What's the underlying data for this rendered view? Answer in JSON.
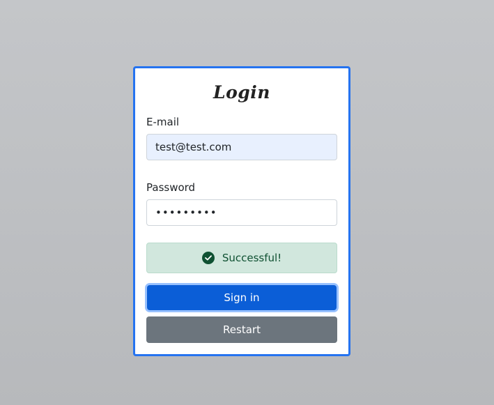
{
  "login": {
    "title": "Login",
    "email_label": "E-mail",
    "email_value": "test@test.com",
    "password_label": "Password",
    "password_value": "test12345",
    "alert_text": "Successful!",
    "signin_label": "Sign in",
    "restart_label": "Restart"
  },
  "colors": {
    "card_border": "#2573f0",
    "primary": "#0b5ed7",
    "secondary": "#6c757d",
    "success_bg": "#d1e7dd",
    "success_text": "#0f5132",
    "autofill_bg": "#e8f0fe"
  },
  "icons": {
    "alert": "check-circle-icon"
  }
}
